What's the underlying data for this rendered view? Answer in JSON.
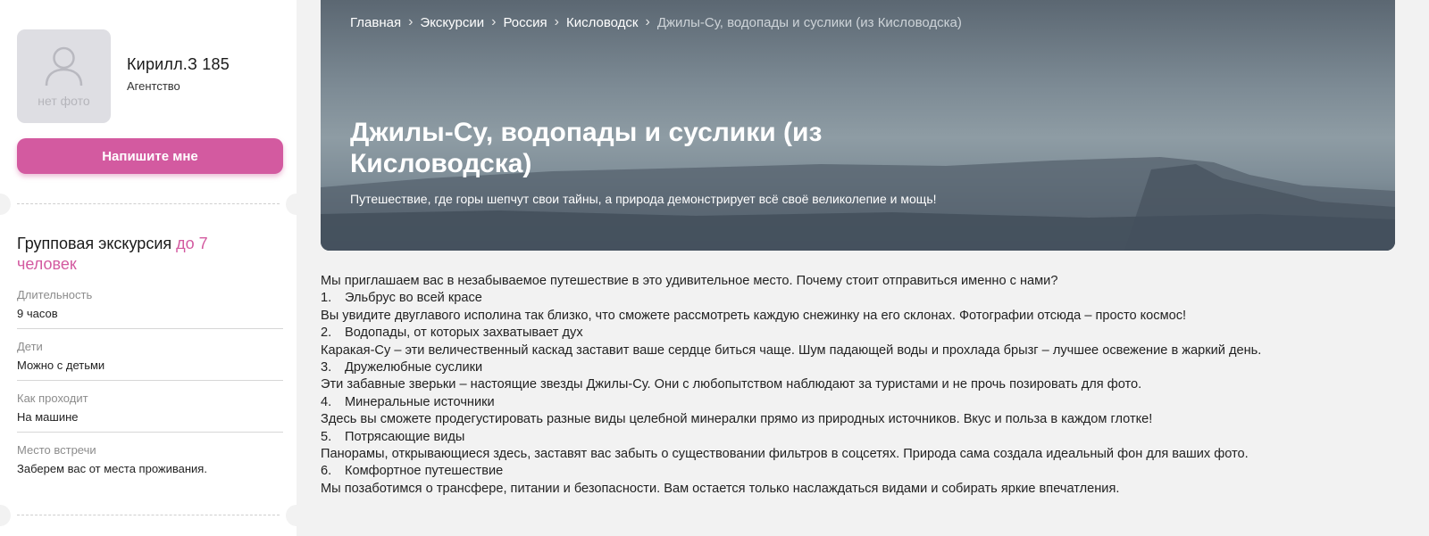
{
  "guide": {
    "avatar_placeholder": "нет фото",
    "name": "Кирилл.З 185",
    "role": "Агентство"
  },
  "contact_button": "Напишите мне",
  "tour": {
    "type_prefix": "Групповая экскурсия",
    "type_accent": "до 7 человек",
    "facts": [
      {
        "label": "Длительность",
        "value": "9 часов"
      },
      {
        "label": "Дети",
        "value": "Можно с детьми"
      },
      {
        "label": "Как проходит",
        "value": "На машине"
      },
      {
        "label": "Место встречи",
        "value": "Заберем вас от места проживания."
      }
    ]
  },
  "breadcrumb": {
    "items": [
      "Главная",
      "Экскурсии",
      "Россия",
      "Кисловодск"
    ],
    "current": "Джилы-Су, водопады и суслики (из Кисловодска)"
  },
  "hero": {
    "title": "Джилы-Су, водопады и суслики (из Кисловодска)",
    "subtitle": "Путешествие, где горы шепчут свои тайны, а природа демонстрирует всё своё великолепие и мощь!"
  },
  "description": {
    "intro": "Мы приглашаем вас в незабываемое путешествие в это удивительное место. Почему стоит отправиться именно с нами?",
    "items": [
      {
        "num": "1.",
        "title": "Эльбрус во всей красе",
        "text": "Вы увидите двуглавого исполина так близко, что сможете рассмотреть каждую снежинку на его склонах. Фотографии отсюда – просто космос!"
      },
      {
        "num": "2.",
        "title": "Водопады, от которых захватывает дух",
        "text": "Каракая-Су – эти величественный каскад заставит ваше сердце биться чаще. Шум падающей воды и прохлада брызг – лучшее освежение в жаркий день."
      },
      {
        "num": "3.",
        "title": "Дружелюбные суслики",
        "text": "Эти забавные зверьки – настоящие звезды Джилы-Су. Они с любопытством наблюдают за туристами и не прочь позировать для фото."
      },
      {
        "num": "4.",
        "title": "Минеральные источники",
        "text": "Здесь вы сможете продегустировать разные виды целебной минералки прямо из природных источников. Вкус и польза в каждом глотке!"
      },
      {
        "num": "5.",
        "title": "Потрясающие виды",
        "text": "Панорамы, открывающиеся здесь, заставят вас забыть о существовании фильтров в соцсетях. Природа сама создала идеальный фон для ваших фото."
      },
      {
        "num": "6.",
        "title": "Комфортное путешествие",
        "text": "Мы позаботимся о трансфере, питании и безопасности. Вам остается только наслаждаться видами и собирать яркие впечатления."
      }
    ]
  }
}
